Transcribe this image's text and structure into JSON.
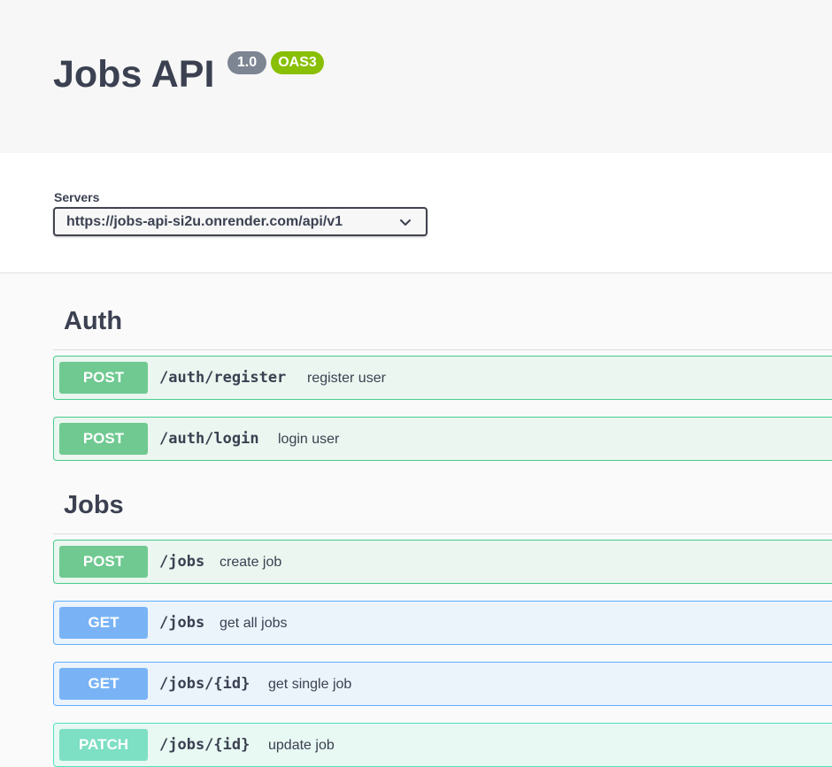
{
  "info": {
    "title": "Jobs API",
    "version_badge": "1.0",
    "oas_badge": "OAS3"
  },
  "servers": {
    "label": "Servers",
    "selected": "https://jobs-api-si2u.onrender.com/api/v1"
  },
  "sections": [
    {
      "title": "Auth",
      "operations": [
        {
          "method": "POST",
          "path": "/auth/register",
          "summary": "register user"
        },
        {
          "method": "POST",
          "path": "/auth/login",
          "summary": "login user"
        }
      ]
    },
    {
      "title": "Jobs",
      "operations": [
        {
          "method": "POST",
          "path": "/jobs",
          "summary": "create job"
        },
        {
          "method": "GET",
          "path": "/jobs",
          "summary": "get all jobs"
        },
        {
          "method": "GET",
          "path": "/jobs/{id}",
          "summary": "get single job"
        },
        {
          "method": "PATCH",
          "path": "/jobs/{id}",
          "summary": "update job"
        }
      ]
    }
  ],
  "colors": {
    "post": "#49cc90",
    "get": "#61affe",
    "patch": "#50e3c2",
    "version_badge": "#7d8492",
    "oas_badge": "#89bf04"
  },
  "icons": {
    "server_dropdown": "chevron-down-icon"
  }
}
